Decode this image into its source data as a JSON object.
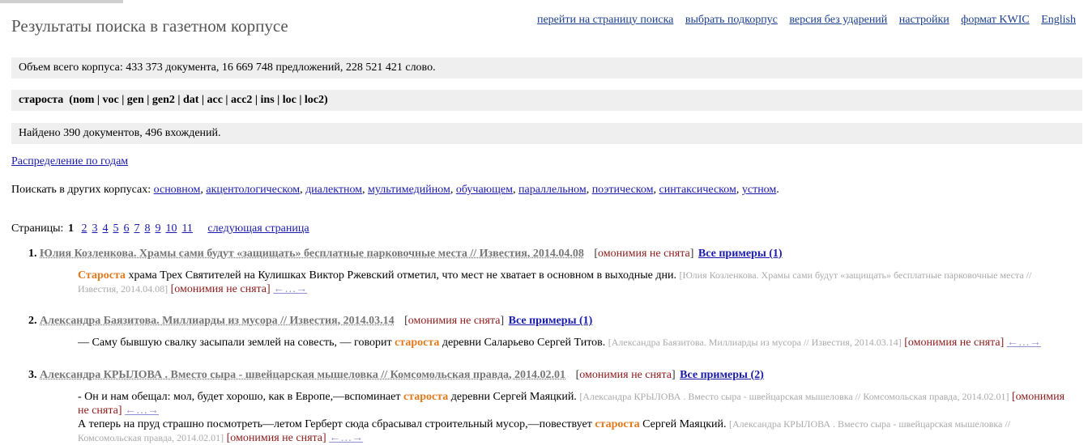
{
  "header": {
    "title": "Результаты поиска в газетном корпусе",
    "nav": [
      "перейти на страницу поиска",
      "выбрать подкорпус",
      "версия без ударений",
      "настройки",
      "формат KWIC",
      "English"
    ]
  },
  "corpus_info": "Объем всего корпуса: 433 373 документа, 16 669 748 предложений, 228 521 421 слово.",
  "query": "староста  (nom | voc | gen | gen2 | dat | acc | acc2 | ins | loc | loc2)",
  "found": "Найдено 390 документов, 496 вхождений.",
  "distribution_link": "Распределение по годам",
  "other_corpora": {
    "label": "Поискать в других корпусах:",
    "links": [
      "основном",
      "акцентологическом",
      "диалектном",
      "мультимедийном",
      "обучающем",
      "параллельном",
      "поэтическом",
      "синтаксическом",
      "устном"
    ],
    "sep": ",",
    "end": "."
  },
  "pagination": {
    "label": "Страницы:",
    "current": "1",
    "pages": [
      "2",
      "3",
      "4",
      "5",
      "6",
      "7",
      "8",
      "9",
      "10",
      "11"
    ],
    "next": "следующая страница"
  },
  "results": [
    {
      "num": "1.",
      "doc": "Юлия Козленкова. Храмы сами будут «защищать» бесплатные парковочные места // Известия, 2014.04.08",
      "omonymy": "омонимия не снята",
      "all_examples": "Все примеры (1)",
      "snippets": [
        {
          "before": "",
          "keyword": "Староста",
          "after": " храма Трех Святителей на Кулишках Виктор Ржевский отметил, что мест не хватает в основном в выходные дни.",
          "source": "[Юлия Козленкова. Храмы сами будут «защищать» бесплатные парковочные места // Известия, 2014.04.08]",
          "omonymy": "[омонимия не снята]",
          "arrows": "←…→"
        }
      ]
    },
    {
      "num": "2.",
      "doc": "Александра Баязитова. Миллиарды из мусора // Известия, 2014.03.14",
      "omonymy": "омонимия не снята",
      "all_examples": "Все примеры (1)",
      "snippets": [
        {
          "before": "— Саму бывшую свалку засыпали землей на совесть, — говорит ",
          "keyword": "староста",
          "after": " деревни Саларьево Сергей Титов.",
          "source": "[Александра Баязитова. Миллиарды из мусора // Известия, 2014.03.14]",
          "omonymy": "[омонимия не снята]",
          "arrows": "←…→"
        }
      ]
    },
    {
      "num": "3.",
      "doc": "Александра КРЫЛОВА . Вместо сыра - швейцарская мышеловка // Комсомольская правда, 2014.02.01",
      "omonymy": "омонимия не снята",
      "all_examples": "Все примеры (2)",
      "snippets": [
        {
          "before": "- Он и нам обещал: мол, будет хорошо, как в Европе,—вспоминает ",
          "keyword": "староста",
          "after": " деревни Сергей Маяцкий.",
          "source": "[Александра КРЫЛОВА . Вместо сыра - швейцарская мышеловка // Комсомольская правда, 2014.02.01]",
          "omonymy": "[омонимия не снята]",
          "arrows": "←…→"
        },
        {
          "before": "А теперь на пруд страшно посмотреть—летом Герберт сюда сбрасывал строительный мусор,—повествует ",
          "keyword": "староста",
          "after": " Сергей Маяцкий.",
          "source": "[Александра КРЫЛОВА . Вместо сыра - швейцарская мышеловка // Комсомольская правда, 2014.02.01]",
          "omonymy": "[омонимия не снята]",
          "arrows": "←…→"
        }
      ]
    }
  ]
}
